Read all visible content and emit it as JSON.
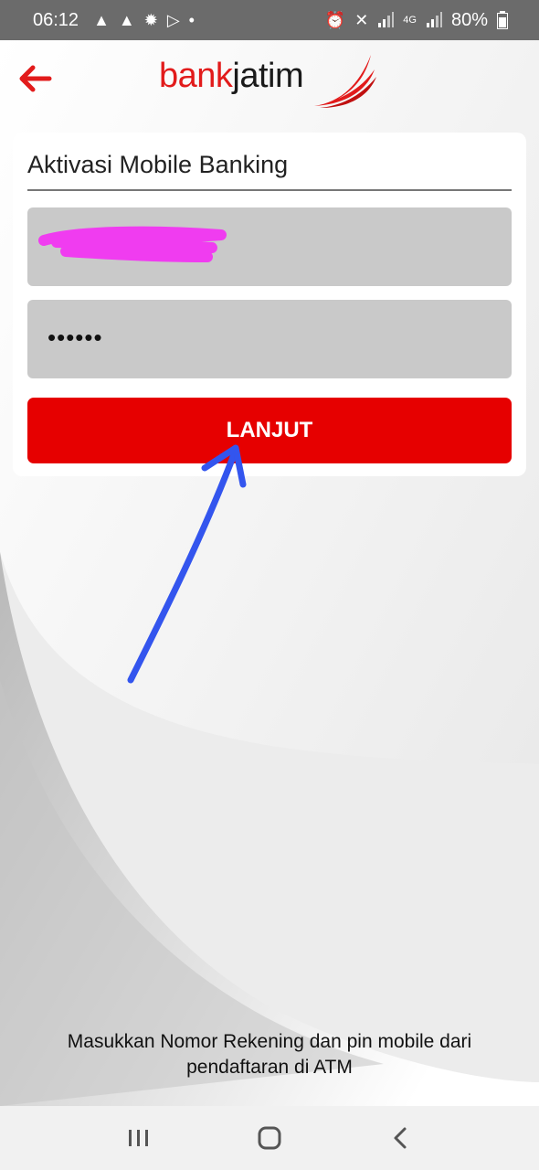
{
  "status_bar": {
    "time": "06:12",
    "left_icons": [
      "warning-icon",
      "warning-icon",
      "settings-icon",
      "play-store-icon",
      "dot-icon"
    ],
    "right_icons": [
      "alarm-icon",
      "mute-icon",
      "signal-icon",
      "4g-signal-icon",
      "signal-icon"
    ],
    "network": "4G",
    "battery": "80%"
  },
  "header": {
    "back_icon": "arrow-left-icon",
    "logo_part1": "bank",
    "logo_part2": "jatim"
  },
  "form": {
    "title": "Aktivasi Mobile Banking",
    "account_value": "",
    "pin_value": "••••••",
    "submit_label": "LANJUT"
  },
  "instruction": {
    "line1": "Masukkan Nomor Rekening dan pin mobile dari",
    "line2": "pendaftaran di ATM"
  },
  "nav_bar": {
    "recents_icon": "recents-icon",
    "home_icon": "home-icon",
    "back_icon": "back-icon"
  },
  "colors": {
    "brand_red": "#e60000",
    "annotation_arrow": "#3355ee",
    "redaction": "#f03cf0"
  }
}
